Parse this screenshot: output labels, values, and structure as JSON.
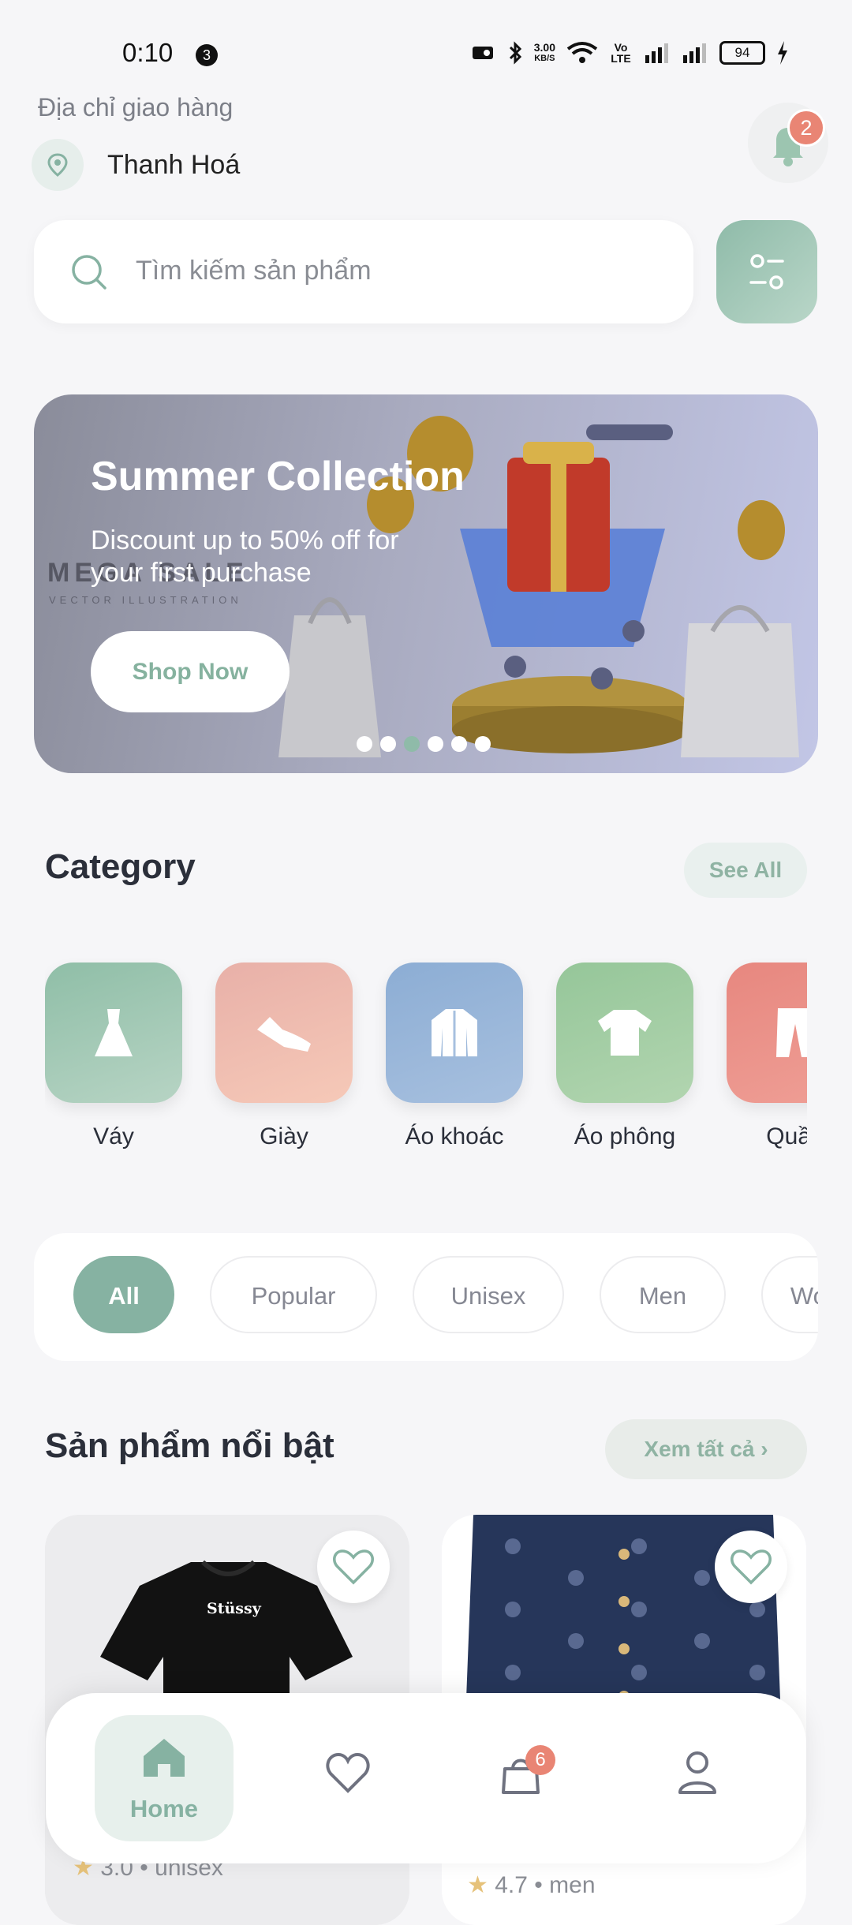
{
  "status_bar": {
    "time": "0:10",
    "notif_count": "3",
    "speed_value": "3.00",
    "speed_unit": "KB/S",
    "volte": "Vo LTE",
    "battery": "94"
  },
  "header": {
    "address_label": "Địa chỉ giao hàng",
    "city": "Thanh Hoá",
    "notification_count": "2"
  },
  "search": {
    "placeholder": "Tìm kiếm sản phẩm"
  },
  "banner": {
    "title": "Summer Collection",
    "subtitle": "Discount up to 50% off for your first purchase",
    "button": "Shop Now",
    "watermark": "MEGA SALE",
    "watermark_sub": "VECTOR ILLUSTRATION",
    "active_dot": 2
  },
  "category": {
    "title": "Category",
    "see_all": "See All",
    "items": [
      {
        "label": "Váy",
        "icon": "dress-icon",
        "color": "#9cc5b0"
      },
      {
        "label": "Giày",
        "icon": "shoe-icon",
        "color": "#eeb4a6"
      },
      {
        "label": "Áo khoác",
        "icon": "jacket-icon",
        "color": "#91b3d6"
      },
      {
        "label": "Áo phông",
        "icon": "tshirt-icon",
        "color": "#9cca9f"
      },
      {
        "label": "Quần",
        "icon": "pants-icon",
        "color": "#e88c84"
      }
    ]
  },
  "filters": {
    "chips": [
      "All",
      "Popular",
      "Unisex",
      "Men",
      "Women"
    ],
    "active": "All"
  },
  "featured": {
    "title": "Sản phẩm nổi bật",
    "view_all": "Xem tất cả",
    "products": [
      {
        "brand": "Stüssy",
        "rating": "3.0",
        "tag": "unisex"
      },
      {
        "rating": "4.7",
        "tag": "men"
      }
    ]
  },
  "bottom_nav": {
    "home": "Home",
    "cart_count": "6"
  },
  "colors": {
    "accent": "#86b2a2",
    "badge": "#e98574"
  }
}
